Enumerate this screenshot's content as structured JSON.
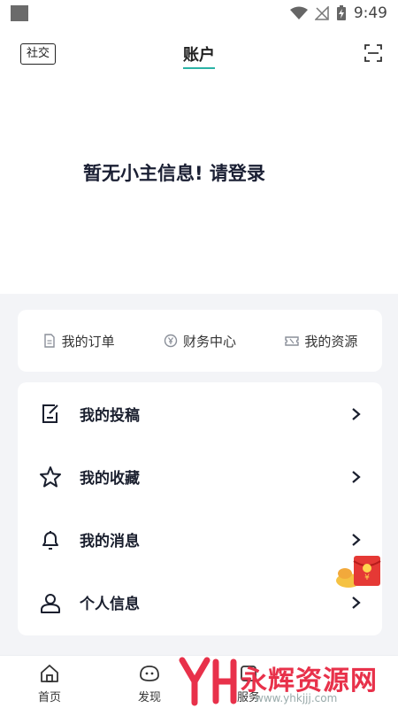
{
  "status": {
    "time": "9:49"
  },
  "header": {
    "social_label": "社交",
    "title": "账户",
    "login_prompt": "暂无小主信息! 请登录"
  },
  "quick_links": [
    {
      "label": "我的订单",
      "icon": "document-icon"
    },
    {
      "label": "财务中心",
      "icon": "yuan-coin-icon"
    },
    {
      "label": "我的资源",
      "icon": "ticket-icon"
    }
  ],
  "menu": [
    {
      "label": "我的投稿",
      "icon": "edit-note-icon"
    },
    {
      "label": "我的收藏",
      "icon": "star-icon"
    },
    {
      "label": "我的消息",
      "icon": "bell-icon"
    },
    {
      "label": "个人信息",
      "icon": "person-icon"
    }
  ],
  "tabs": [
    {
      "label": "首页",
      "icon": "home-icon"
    },
    {
      "label": "发现",
      "icon": "discover-icon"
    },
    {
      "label": "服务",
      "icon": "service-icon"
    }
  ],
  "watermark": {
    "text": "永辉资源网",
    "url": "www.yhkjjj.com"
  },
  "colors": {
    "accent": "#2bb3a5",
    "watermark": "#e8314a"
  }
}
